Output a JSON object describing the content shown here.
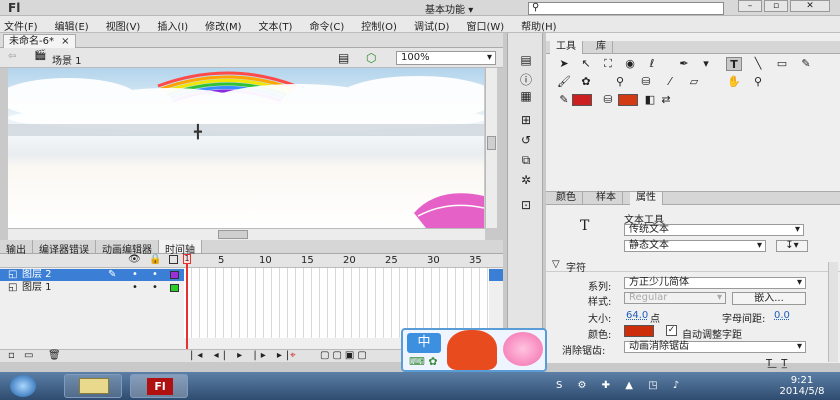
{
  "app": {
    "logo": "Fl",
    "workspace": "基本功能",
    "search_icon": "search-icon",
    "window_controls": [
      "–",
      "▫",
      "✕"
    ]
  },
  "menu": [
    "文件(F)",
    "编辑(E)",
    "视图(V)",
    "插入(I)",
    "修改(M)",
    "文本(T)",
    "命令(C)",
    "控制(O)",
    "调试(D)",
    "窗口(W)",
    "帮助(H)"
  ],
  "document": {
    "tab": "未命名-6*",
    "close": "×",
    "scene": "场景 1",
    "zoom": "100%"
  },
  "bottom_tabs": [
    "输出",
    "编译器错误",
    "动画编辑器",
    "时间轴"
  ],
  "timeline": {
    "frame_numbers": [
      "5",
      "10",
      "15",
      "20",
      "25",
      "30",
      "35"
    ],
    "layers": [
      {
        "name": "图层 2",
        "selected": true,
        "color": "#9b30d9"
      },
      {
        "name": "图层 1",
        "selected": false,
        "color": "#2ad02a"
      }
    ],
    "current_frame": "1"
  },
  "tools_panel": {
    "tabs": [
      "工具",
      "库"
    ],
    "stroke_color": "#cc1f1f",
    "fill_color": "#d23a16"
  },
  "properties": {
    "tabs": [
      "颜色",
      "样本",
      "属性"
    ],
    "tool_icon": "T",
    "tool_name": "文本工具",
    "text_type": "传统文本",
    "text_mode": "静态文本",
    "section": "字符",
    "family_label": "系列:",
    "family_value": "方正少儿简体",
    "style_label": "样式:",
    "style_value": "Regular",
    "embed_button": "嵌入...",
    "size_label": "大小:",
    "size_value": "64.0",
    "size_unit": "点",
    "spacing_label": "字母间距:",
    "spacing_value": "0.0",
    "color_label": "颜色:",
    "text_color": "#cc2d0a",
    "autokern_label": "自动调整字距",
    "autokern_checked": true,
    "antialias_label": "消除锯齿:",
    "antialias_value": "动画消除锯齿"
  },
  "ime": {
    "label": "中"
  },
  "clock": {
    "time": "9:21",
    "date": "2014/5/8"
  }
}
